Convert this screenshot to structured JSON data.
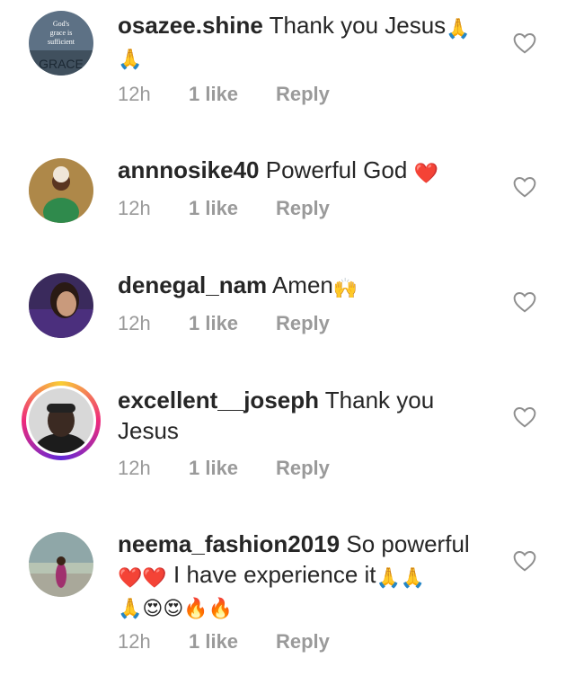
{
  "comments": [
    {
      "username": "osazee.shine",
      "text": "Thank you Jesus",
      "emoji_after": [
        "🙏",
        "🙏"
      ],
      "time": "12h",
      "likes": "1 like",
      "reply": "Reply",
      "avatar_text": [
        "God's",
        "grace is",
        "sufficient",
        "GRACE"
      ]
    },
    {
      "username": "annnosike40",
      "text": "Powerful God",
      "emoji_after": [
        "❤️"
      ],
      "time": "12h",
      "likes": "1 like",
      "reply": "Reply"
    },
    {
      "username": "denegal_nam",
      "text": "Amen",
      "emoji_after": [
        "🙌"
      ],
      "time": "12h",
      "likes": "1 like",
      "reply": "Reply"
    },
    {
      "username": "excellent__joseph",
      "text": "Thank you Jesus",
      "emoji_after": [],
      "time": "12h",
      "likes": "1 like",
      "reply": "Reply",
      "has_story_ring": true
    },
    {
      "username": "neema_fashion2019",
      "text": "So powerful",
      "text_2": "I have experience it",
      "emoji_line_1": [
        "❤️",
        "❤️"
      ],
      "emoji_line_2": [
        "🙏",
        "🙏"
      ],
      "emoji_line_3": [
        "🙏",
        "😍",
        "😍",
        "🔥",
        "🔥"
      ],
      "time": "12h",
      "likes": "1 like",
      "reply": "Reply"
    }
  ],
  "icons": {
    "like": "heart-outline-icon"
  },
  "colors": {
    "text": "#262626",
    "meta": "#9a9a9a",
    "heart_outline": "#8e8e8e"
  }
}
